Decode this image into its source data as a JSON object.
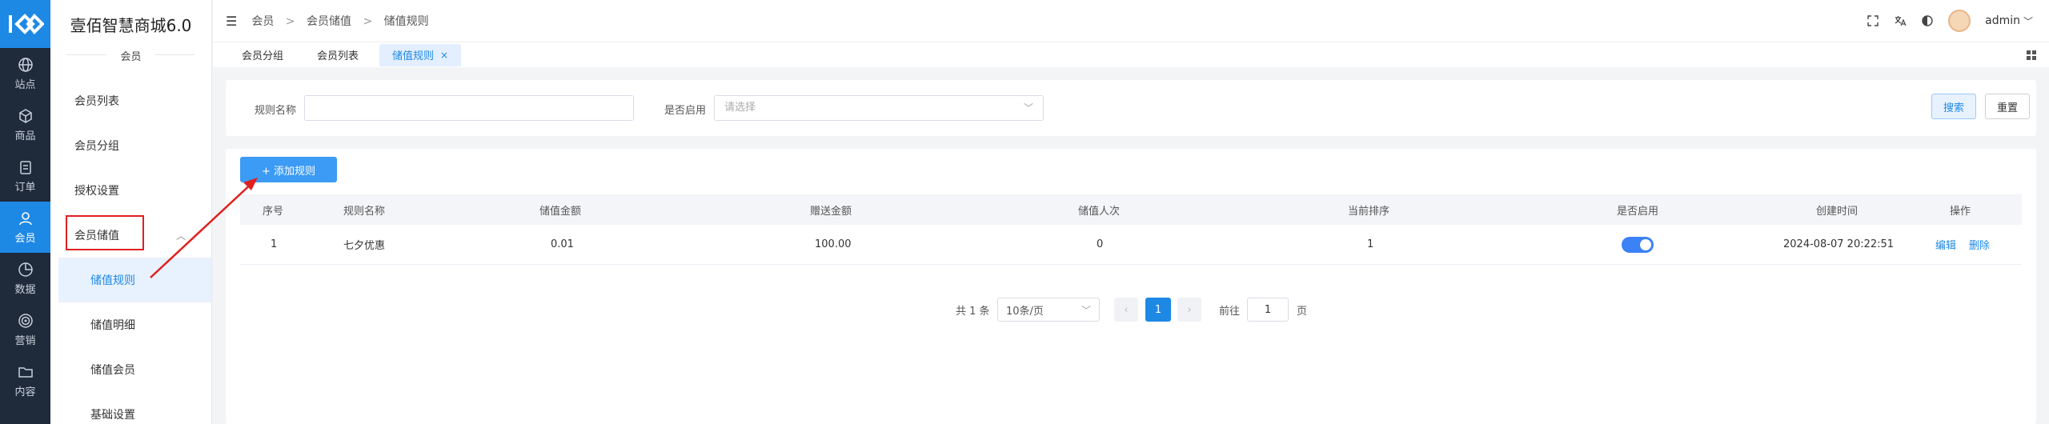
{
  "rail": {
    "items": [
      {
        "label": "站点",
        "icon": "globe-icon"
      },
      {
        "label": "商品",
        "icon": "box-icon"
      },
      {
        "label": "订单",
        "icon": "clipboard-icon"
      },
      {
        "label": "会员",
        "icon": "user-icon"
      },
      {
        "label": "数据",
        "icon": "pie-chart-icon"
      },
      {
        "label": "营销",
        "icon": "target-icon"
      },
      {
        "label": "内容",
        "icon": "folder-icon"
      }
    ]
  },
  "sidebar": {
    "brand": "壹佰智慧商城6.0",
    "section": "会员",
    "items": [
      "会员列表",
      "会员分组",
      "授权设置"
    ],
    "group": "会员储值",
    "sub_items": [
      "储值规则",
      "储值明细",
      "储值会员",
      "基础设置"
    ]
  },
  "header": {
    "breadcrumb": [
      "会员",
      "会员储值",
      "储值规则"
    ],
    "sep": ">",
    "user": "admin"
  },
  "tabs": [
    {
      "label": "会员分组"
    },
    {
      "label": "会员列表"
    },
    {
      "label": "储值规则",
      "close": "×"
    }
  ],
  "filter": {
    "name_label": "规则名称",
    "name_value": "",
    "enabled_label": "是否启用",
    "enabled_placeholder": "请选择",
    "search": "搜索",
    "reset": "重置"
  },
  "table": {
    "add_button": "+ 添加规则",
    "columns": [
      "序号",
      "规则名称",
      "储值金额",
      "赠送金额",
      "储值人次",
      "当前排序",
      "是否启用",
      "创建时间",
      "操作"
    ],
    "rows": [
      {
        "index": "1",
        "name": "七夕优惠",
        "amount": "0.01",
        "gift": "100.00",
        "count": "0",
        "sort": "1",
        "enabled": true,
        "created": "2024-08-07 20:22:51",
        "edit": "编辑",
        "delete": "删除"
      }
    ]
  },
  "pagination": {
    "total": "共 1 条",
    "page_size": "10条/页",
    "prev": "‹",
    "current": "1",
    "next": "›",
    "goto_label": "前往",
    "goto_value": "1",
    "page_suffix": "页"
  },
  "colors": {
    "accent": "#1e88e5",
    "rail_bg": "#1f2a3a",
    "annotation": "#e02020"
  }
}
